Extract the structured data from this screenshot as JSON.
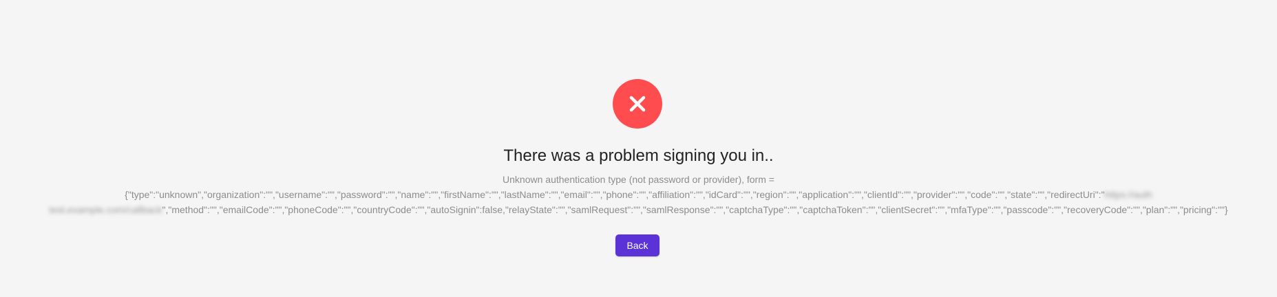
{
  "result": {
    "icon": "close-icon",
    "icon_color": "#ff4d4f",
    "title": "There was a problem signing you in..",
    "subtitle": {
      "line1": "Unknown authentication type (not password or provider), form =",
      "line2_start": "{\"type\":\"unknown\",\"organization\":\"\",\"username\":\"\",\"password\":\"\",\"name\":\"\",\"firstName\":\"\",\"lastName\":\"\",\"email\":\"\",\"phone\":\"\",\"affiliation\":\"\",\"idCard\":\"\",\"region\":\"\",\"application\":\"\",\"clientId\":\"\",\"provider\":\"\",\"code\":\"\",\"state\":\"\",\"redirectUri\":\"",
      "line2_redacted": "https://auth",
      "line3_redacted": "test.example.com/callback",
      "line3_end": "\",\"method\":\"\",\"emailCode\":\"\",\"phoneCode\":\"\",\"countryCode\":\"\",\"autoSignin\":false,\"relayState\":\"\",\"samlRequest\":\"\",\"samlResponse\":\"\",\"captchaType\":\"\",\"captchaToken\":\"\",\"clientSecret\":\"\",\"mfaType\":\"\",\"passcode\":\"\",\"recoveryCode\":\"\",\"plan\":\"\",\"pricing\":\"\"}"
    },
    "back_label": "Back",
    "accent_color": "#5b32d6"
  }
}
